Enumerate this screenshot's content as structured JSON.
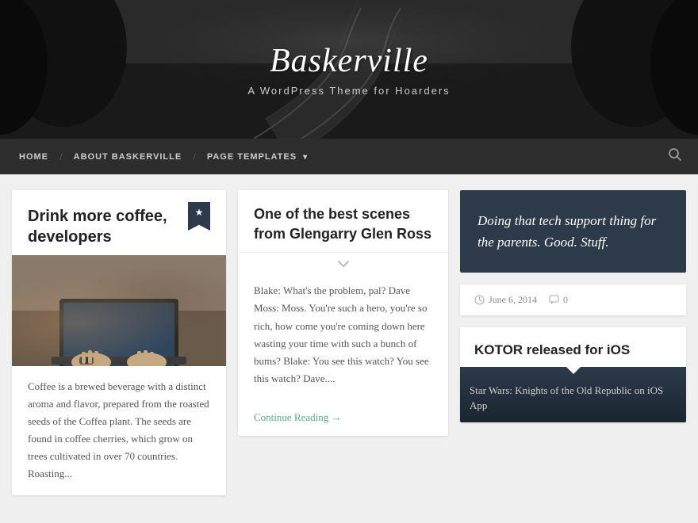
{
  "header": {
    "title": "Baskerville",
    "tagline": "A WordPress Theme for Hoarders",
    "bg_description": "Dark road scene"
  },
  "nav": {
    "items": [
      {
        "label": "HOME",
        "has_separator": false
      },
      {
        "label": "ABOUT BASKERVILLE",
        "has_separator": true
      },
      {
        "label": "PAGE TEMPLATES",
        "has_separator": true,
        "has_dropdown": true
      }
    ],
    "search_icon": "🔍"
  },
  "left_card": {
    "title": "Drink more coffee, developers",
    "image_alt": "Hands on laptop with coffee",
    "description": "Coffee is a brewed beverage with a distinct aroma and flavor, prepared from the roasted seeds of the Coffea plant. The seeds are found in coffee cherries, which grow on trees cultivated in over 70 countries. Roasting..."
  },
  "mid_card": {
    "title": "One of the best scenes from Glengarry Glen Ross",
    "body": "Blake: What's the problem, pal? Dave Moss: Moss. You're such a hero, you're so rich, how come you're coming down here wasting your time with such a bunch of bums? Blake: You see this watch? You see this watch? Dave....",
    "continue_label": "Continue Reading →"
  },
  "right_col": {
    "quote_card": {
      "text": "Doing that tech support thing for the parents. Good. Stuff.",
      "date": "June 6, 2014",
      "comments_count": "0"
    },
    "kotor_card": {
      "title": "KOTOR released for iOS",
      "body": "Star Wars: Knights of the Old Republic on iOS App"
    }
  }
}
